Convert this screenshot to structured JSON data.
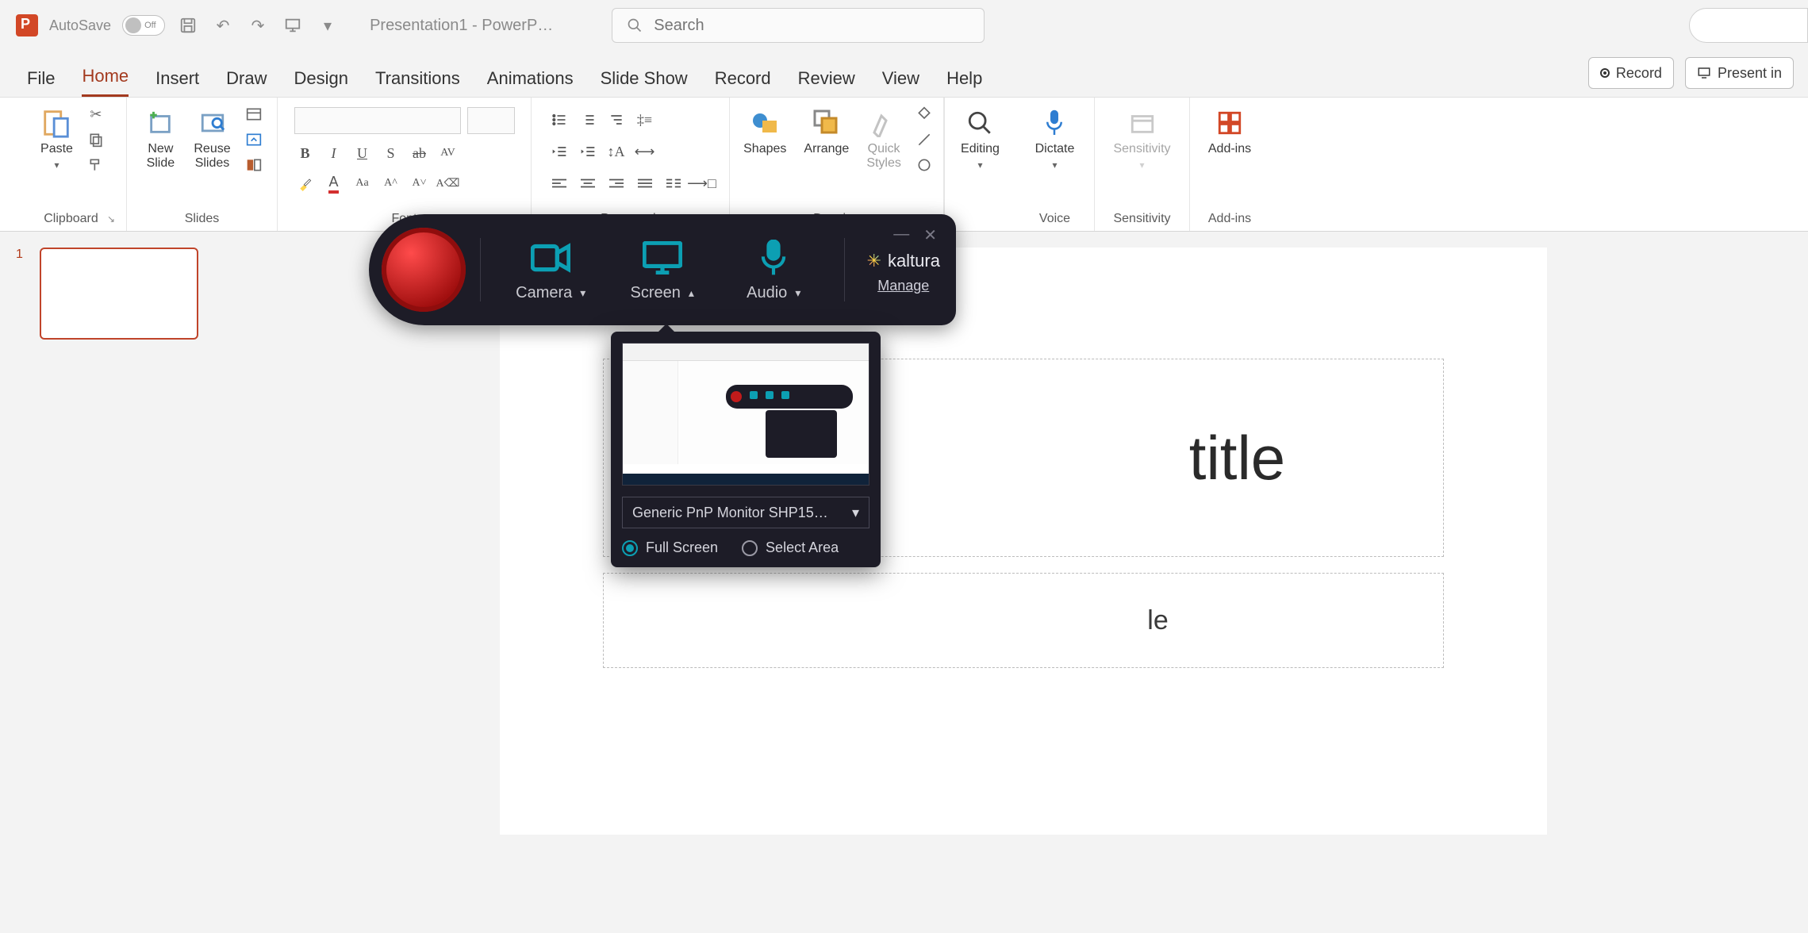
{
  "titlebar": {
    "autosave_label": "AutoSave",
    "autosave_state": "Off",
    "doc_title": "Presentation1 - PowerP…",
    "search_placeholder": "Search"
  },
  "tabs": {
    "items": [
      "File",
      "Home",
      "Insert",
      "Draw",
      "Design",
      "Transitions",
      "Animations",
      "Slide Show",
      "Record",
      "Review",
      "View",
      "Help"
    ],
    "active_index": 1,
    "record_btn": "Record",
    "present_btn": "Present in"
  },
  "ribbon": {
    "clipboard": {
      "label": "Clipboard",
      "paste": "Paste"
    },
    "slides": {
      "label": "Slides",
      "new_slide": "New\nSlide",
      "reuse": "Reuse\nSlides"
    },
    "font": {
      "label": "Font"
    },
    "paragraph": {
      "label": "Paragraph"
    },
    "drawing": {
      "label": "Drawing",
      "shapes": "Shapes",
      "arrange": "Arrange",
      "quick": "Quick\nStyles"
    },
    "editing": {
      "label": "Editing",
      "btn": "Editing"
    },
    "voice": {
      "label": "Voice",
      "dictate": "Dictate"
    },
    "sensitivity": {
      "label": "Sensitivity",
      "btn": "Sensitivity"
    },
    "addins": {
      "label": "Add-ins",
      "btn": "Add-ins"
    }
  },
  "thumbs": {
    "num": "1"
  },
  "slide": {
    "title_placeholder": "title",
    "subtitle_suffix": "le"
  },
  "kaltura": {
    "camera": "Camera",
    "screen": "Screen",
    "audio": "Audio",
    "brand": "kaltura",
    "manage": "Manage",
    "monitor": "Generic PnP Monitor SHP15…",
    "full_screen": "Full Screen",
    "select_area": "Select Area"
  }
}
